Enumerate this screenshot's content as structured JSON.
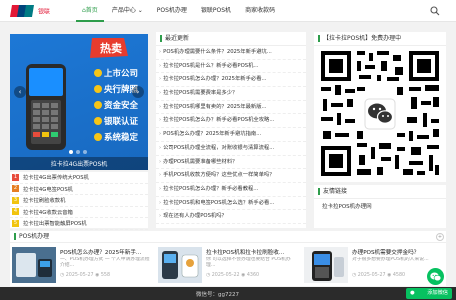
{
  "header": {
    "logo_cn": "银联",
    "nav": [
      {
        "label": "⌂首页",
        "active": true
      },
      {
        "label": "产品中心 ⌄",
        "active": false
      },
      {
        "label": "POS机办理",
        "active": false
      },
      {
        "label": "银联POS机",
        "active": false
      },
      {
        "label": "商家收款码",
        "active": false
      }
    ]
  },
  "slider": {
    "caption": "拉卡拉4G出票POS机",
    "badge": "热卖",
    "promo": [
      "上市公司",
      "央行牌照",
      "资金安全",
      "银联认证",
      "系统稳定"
    ]
  },
  "tag_list": [
    {
      "num": "1",
      "title": "拉卡拉4G出票传统大POS机",
      "color": "#e74c3c"
    },
    {
      "num": "2",
      "title": "拉卡拉4G电签POS机",
      "color": "#e67e22"
    },
    {
      "num": "3",
      "title": "拉卡拉刷脸收款机",
      "color": "#f1c40f"
    },
    {
      "num": "4",
      "title": "拉卡拉4G收款云音箱",
      "color": "#f1c40f"
    },
    {
      "num": "5",
      "title": "拉卡拉出票智能触屏POS机",
      "color": "#f1c40f"
    }
  ],
  "latest": {
    "title": "最近更新",
    "items": [
      "POS机办理需要什么条件？2025年新手避坑...",
      "拉卡拉POS机是什么？新手必看POS机...",
      "拉卡拉POS机怎么办理？2025年新手必看...",
      "拉卡拉POS机需要费率是多少？",
      "拉卡拉POS机哪里有卖的？2025年最新版...",
      "拉卡拉POS机怎么办？新手必看POS机全攻略...",
      "POS机怎么办理？2025年新手避坑指南...",
      "公司POS机办理全流程，对账收银与清算流程...",
      "办理POS机需要准备哪些材料？",
      "手机POS机收款方便吗？这些优点一样简单吗？",
      "拉卡拉POS机怎么办理？新手必看教程...",
      "拉卡拉POS机和电签POS机怎么选？新手必看...",
      "现在还有人办理POS机吗？",
      "拉卡拉POS机需要要求么？"
    ]
  },
  "qr_card": {
    "title": "【拉卡拉POS机】免费办理中"
  },
  "links": {
    "title": "友情链接",
    "items": [
      "拉卡拉POS机办理网"
    ]
  },
  "pos_section": {
    "title": "POS机办理",
    "cards": [
      {
        "title": "POS机怎么办理？2025年新手...",
        "desc": "一、POS机办理方式 一 个人申请办理流程介绍...",
        "date": "2025-05-27",
        "views": "558"
      },
      {
        "title": "拉卡拉POS机和拉卡拉刷脸收...",
        "desc": "你 可以选择不会办理也要结合 POS机办理...",
        "date": "2025-05-22",
        "views": "4360"
      },
      {
        "title": "办理POS机需要交押金吗？",
        "desc": "对于很多想要办理POS机的人来说...",
        "date": "2025-05-27",
        "views": "4580"
      }
    ]
  },
  "footer": {
    "text": "微信号：gg7227",
    "button": "添加微信"
  },
  "colors": {
    "accent": "#2e9d4b",
    "wechat": "#07c160",
    "footer_bg": "#2b2b2b"
  }
}
